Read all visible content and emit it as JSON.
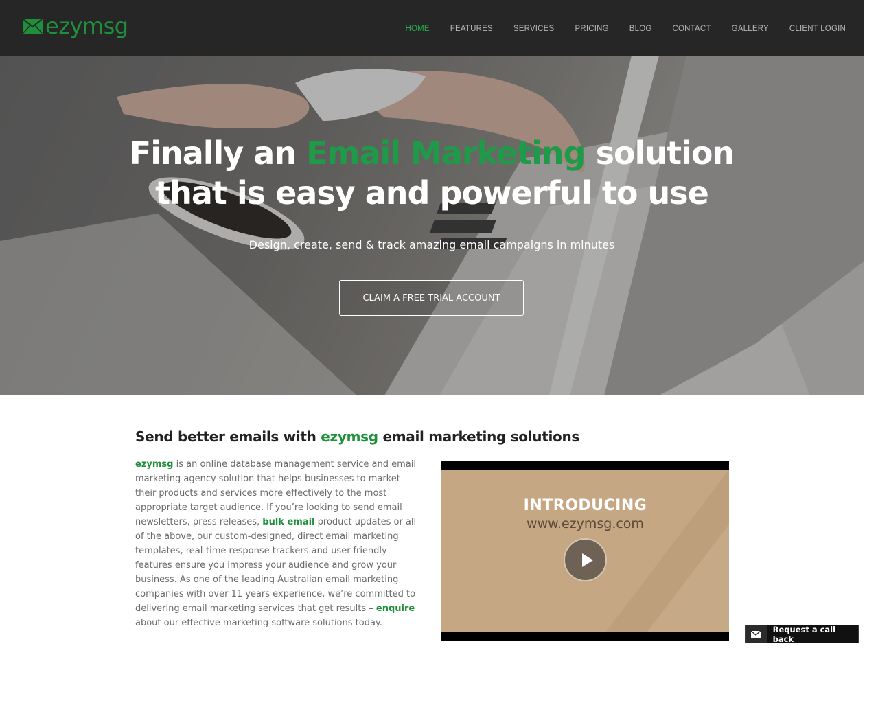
{
  "brand": {
    "name": "ezymsg",
    "accent": "#1e8f3a"
  },
  "nav": {
    "items": [
      {
        "label": "HOME",
        "active": true
      },
      {
        "label": "FEATURES",
        "active": false
      },
      {
        "label": "SERVICES",
        "active": false
      },
      {
        "label": "PRICING",
        "active": false
      },
      {
        "label": "BLOG",
        "active": false
      },
      {
        "label": "CONTACT",
        "active": false
      },
      {
        "label": "GALLERY",
        "active": false
      },
      {
        "label": "CLIENT LOGIN",
        "active": false
      }
    ]
  },
  "hero": {
    "title_before": "Finally an",
    "title_highlight": "Email Marketing",
    "title_after": "solution",
    "title_line2": "that is easy and powerful to use",
    "subtitle": "Design, create, send & track amazing email campaigns in minutes",
    "cta_label": "CLAIM A FREE TRIAL ACCOUNT"
  },
  "intro": {
    "heading_before": "Send better emails with",
    "heading_brand": "ezymsg",
    "heading_after": "email marketing solutions",
    "brand_word": "ezymsg",
    "text_1": " is an online database management service and email marketing agency solution that helps businesses to market their products and services more effectively to the most appropriate target audience. If you’re looking to send email newsletters, press releases, ",
    "link_bulk_email": "bulk email",
    "text_2": " product updates or all of the above, our custom-designed, direct email marketing templates, real-time response trackers and user-friendly features ensure you impress your audience and grow your business. As one of the leading Australian email marketing companies with over 11 years experience, we’re committed to delivering email marketing services that get results – ",
    "link_enquire": "enquire",
    "text_3": " about our effective marketing software solutions today."
  },
  "video": {
    "title": "INTRODUCING",
    "url": "www.ezymsg.com",
    "icon": "play-icon"
  },
  "callback": {
    "label": "Request a call back",
    "icon": "envelope-icon"
  }
}
